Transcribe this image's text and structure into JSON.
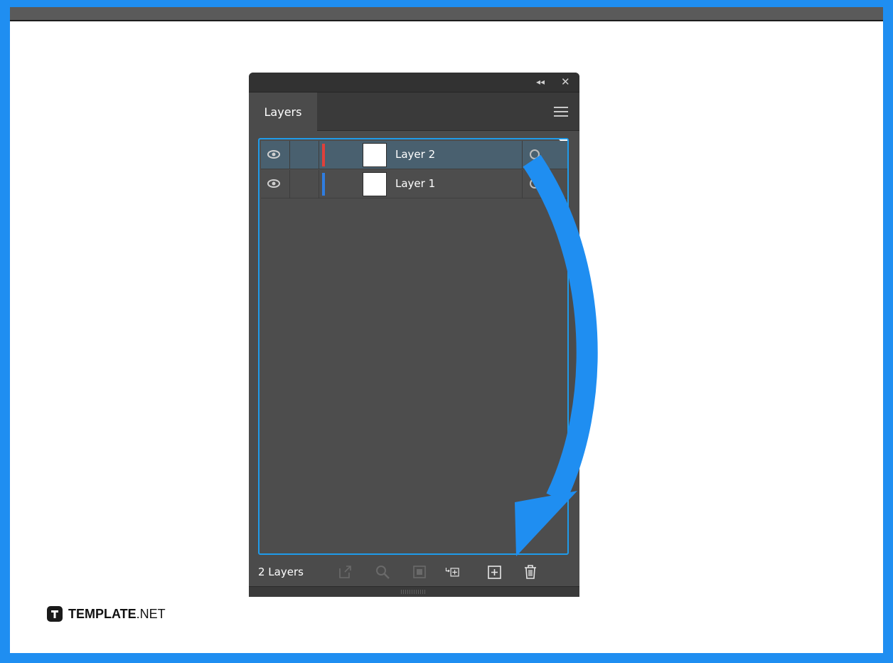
{
  "panel": {
    "tabs": [
      {
        "label": "Layers"
      }
    ],
    "layers": [
      {
        "name": "Layer 2",
        "color": "#e0403a",
        "selected": true
      },
      {
        "name": "Layer 1",
        "color": "#2f7de0",
        "selected": false
      }
    ],
    "footer": {
      "layer_count": "2 Layers",
      "icons": [
        "export-icon",
        "locate-object-icon",
        "clipping-mask-icon",
        "new-sublayer-icon",
        "new-layer-icon",
        "delete-icon"
      ]
    }
  },
  "brand": {
    "name_bold": "TEMPLATE",
    "name_suffix": ".NET"
  },
  "colors": {
    "accent": "#1f8ef1",
    "panel_bg": "#4b4b4b",
    "selection": "#49606f"
  }
}
